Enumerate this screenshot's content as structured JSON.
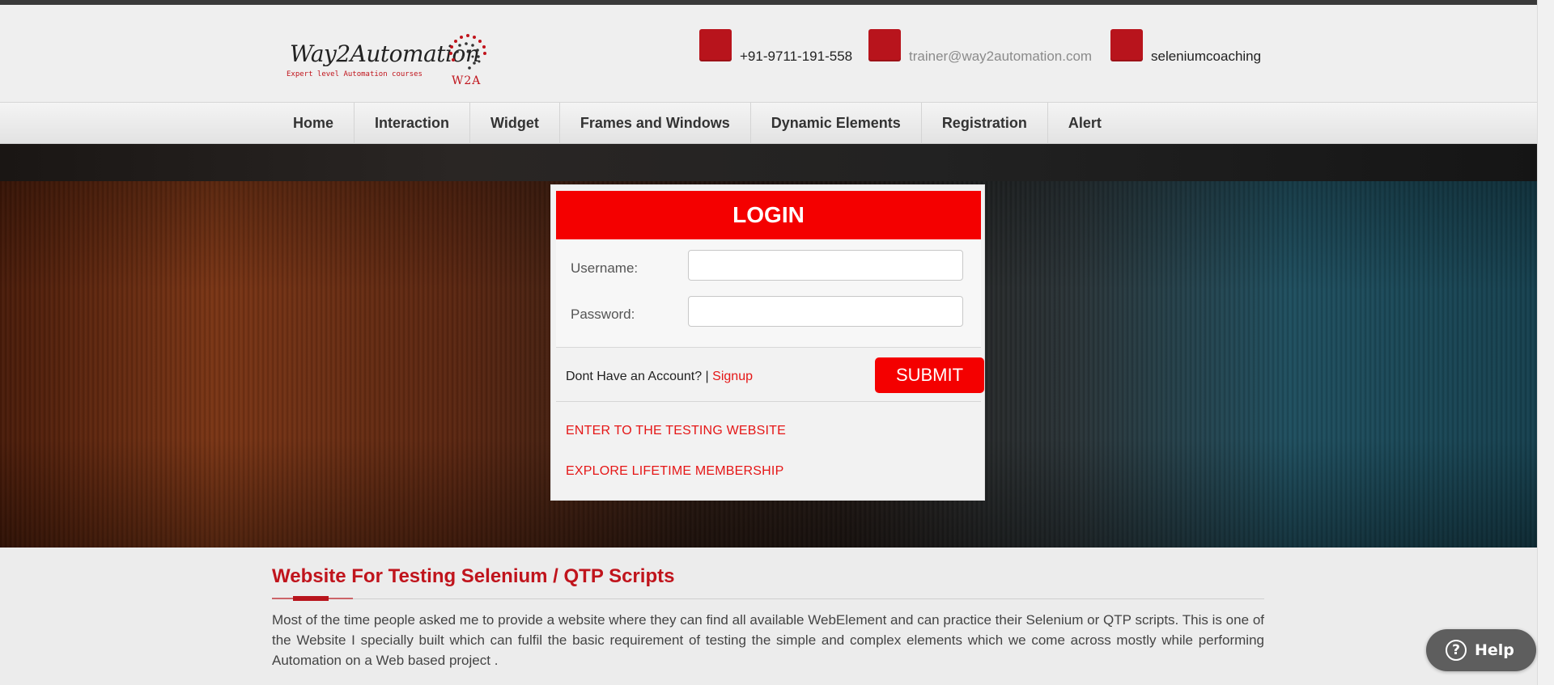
{
  "header": {
    "logo": {
      "name": "Way2Automation",
      "tagline": "Expert level Automation courses",
      "mark": "W2A"
    },
    "contacts": [
      {
        "icon": "phone-icon",
        "text": "+91-9711-191-558"
      },
      {
        "icon": "email-icon",
        "text": "trainer@way2automation.com"
      },
      {
        "icon": "skype-icon",
        "text": "seleniumcoaching"
      }
    ]
  },
  "nav": {
    "items": [
      "Home",
      "Interaction",
      "Widget",
      "Frames and Windows",
      "Dynamic Elements",
      "Registration",
      "Alert"
    ]
  },
  "login": {
    "title": "LOGIN",
    "username_label": "Username:",
    "username_value": "",
    "password_label": "Password:",
    "password_value": "",
    "account_text": "Dont Have an Account? |",
    "signup_label": "Signup",
    "submit_label": "SUBMIT",
    "links": [
      "ENTER TO THE TESTING WEBSITE",
      "EXPLORE LIFETIME MEMBERSHIP"
    ]
  },
  "content": {
    "title": "Website For Testing Selenium / QTP Scripts",
    "paragraph": "Most of the time people asked me to provide a website where they can find all available WebElement and can practice their Selenium or QTP scripts. This is one of the Website I specially built which can fulfil the basic requirement of testing the simple and complex elements which we come across mostly while performing Automation on a Web based project ."
  },
  "help": {
    "label": "Help"
  },
  "colors": {
    "accent": "#f40000",
    "brand": "#c0141c",
    "icon_bg": "#b8141c"
  }
}
